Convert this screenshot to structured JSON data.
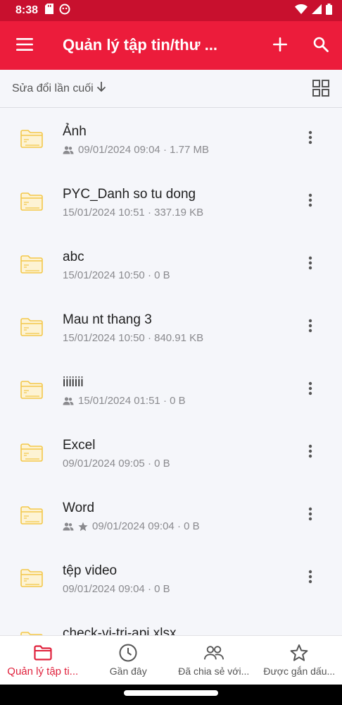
{
  "status_bar": {
    "time": "8:38",
    "icons": [
      "sd-card-icon",
      "app-notification-icon",
      "wifi-icon",
      "signal-icon",
      "battery-icon"
    ]
  },
  "app_bar": {
    "title": "Quản lý tập tin/thư ...",
    "icons": [
      "menu-icon",
      "add-icon",
      "search-icon"
    ]
  },
  "sort_bar": {
    "sort_label": "Sửa đổi lần cuối",
    "sort_direction_icon": "arrow-down-icon",
    "view_toggle_icon": "grid-view-icon"
  },
  "files": [
    {
      "name": "Ảnh",
      "meta": "09/01/2024 09:04 · 1.77 MB",
      "shared": true,
      "starred": false
    },
    {
      "name": "PYC_Danh so tu dong",
      "meta": "15/01/2024 10:51 · 337.19 KB",
      "shared": false,
      "starred": false
    },
    {
      "name": "abc",
      "meta": "15/01/2024 10:50 · 0 B",
      "shared": false,
      "starred": false
    },
    {
      "name": "Mau nt thang 3",
      "meta": "15/01/2024 10:50 · 840.91 KB",
      "shared": false,
      "starred": false
    },
    {
      "name": "iiiiiii",
      "meta": "15/01/2024 01:51 · 0 B",
      "shared": true,
      "starred": false
    },
    {
      "name": "Excel",
      "meta": "09/01/2024 09:05 · 0 B",
      "shared": false,
      "starred": false
    },
    {
      "name": "Word",
      "meta": "09/01/2024 09:04 · 0 B",
      "shared": true,
      "starred": true
    },
    {
      "name": "tệp video",
      "meta": "09/01/2024 09:04 · 0 B",
      "shared": false,
      "starred": false
    },
    {
      "name": "check-vi-tri-api.xlsx",
      "meta": "",
      "shared": false,
      "starred": false
    }
  ],
  "bottom_nav": [
    {
      "label": "Quản lý tập ti...",
      "icon": "folder-icon",
      "active": true
    },
    {
      "label": "Gần đây",
      "icon": "clock-icon",
      "active": false
    },
    {
      "label": "Đã chia sẻ với...",
      "icon": "people-icon",
      "active": false
    },
    {
      "label": "Được gắn dấu...",
      "icon": "star-icon",
      "active": false
    }
  ],
  "colors": {
    "app_bar": "#ec1c3b",
    "status_bar": "#c8102e",
    "folder": "#f3c84b",
    "active_nav": "#e0213c"
  }
}
